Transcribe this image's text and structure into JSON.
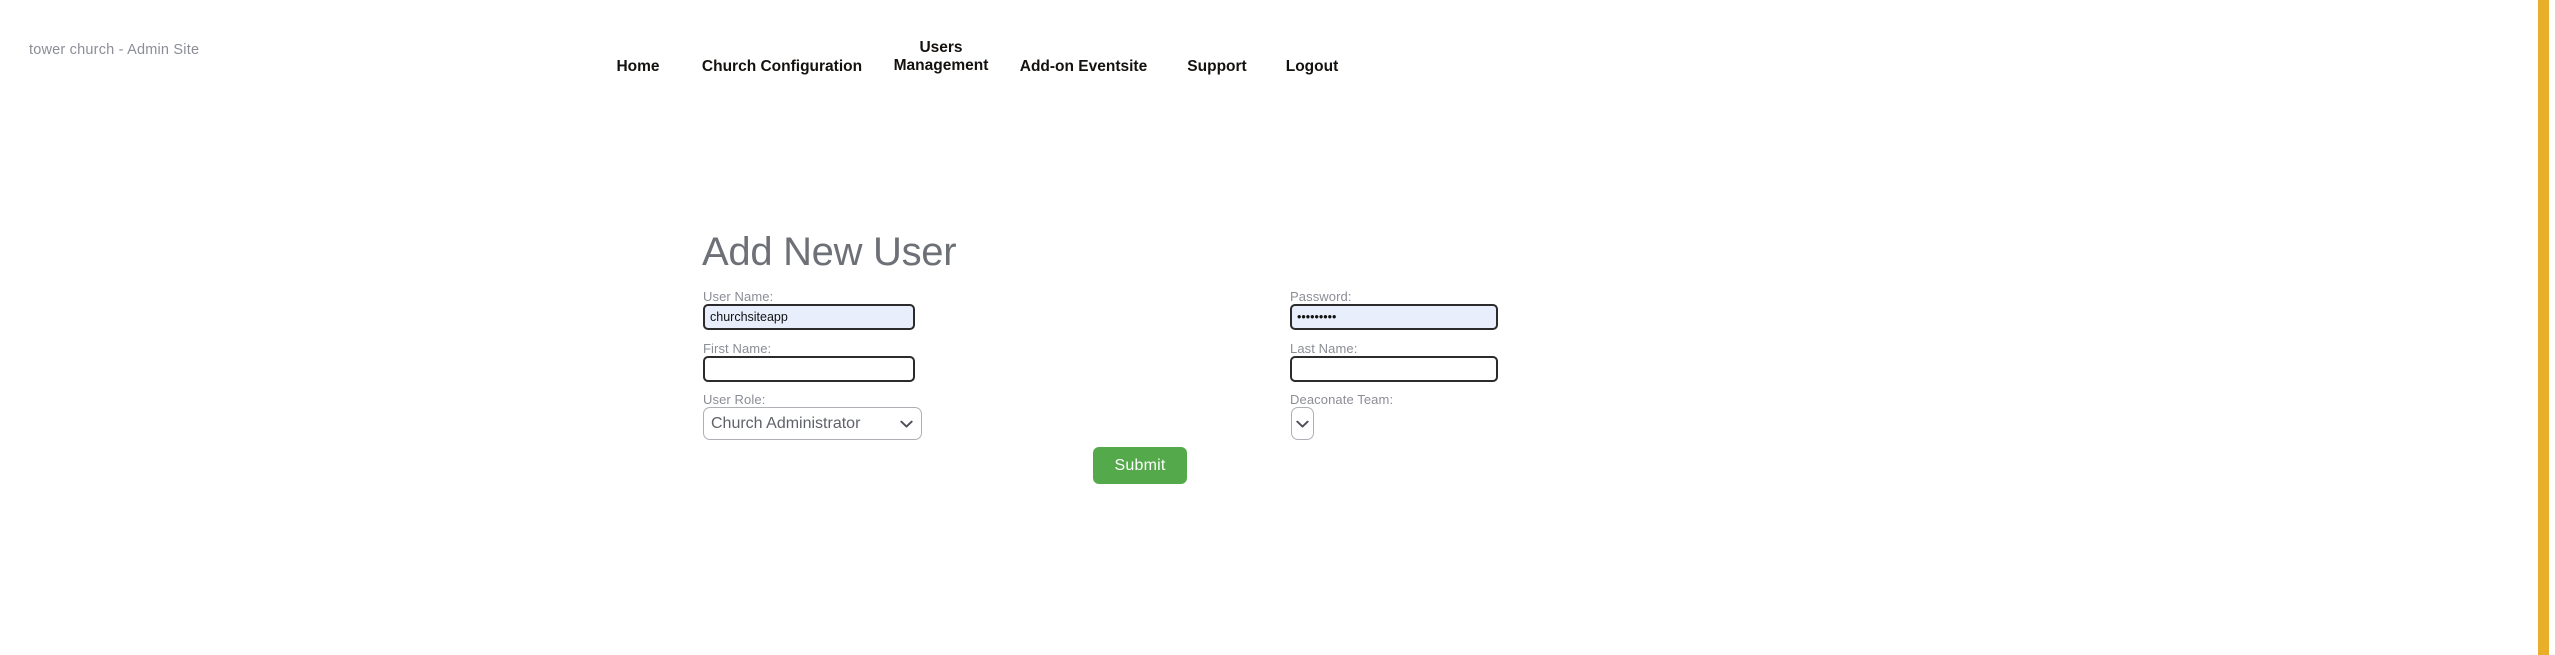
{
  "header": {
    "site_title": "tower church - Admin Site"
  },
  "nav": {
    "items": [
      {
        "label": "Home",
        "name": "nav-home"
      },
      {
        "label": "Church Configuration",
        "name": "nav-church-configuration"
      },
      {
        "label": "Users Management",
        "name": "nav-users-management"
      },
      {
        "label": "Add-on Eventsite",
        "name": "nav-addon-eventsite"
      },
      {
        "label": "Support",
        "name": "nav-support"
      },
      {
        "label": "Logout",
        "name": "nav-logout"
      }
    ]
  },
  "form": {
    "title": "Add New User",
    "fields": {
      "user_name": {
        "label": "User Name:",
        "value": "churchsiteapp",
        "placeholder": ""
      },
      "password": {
        "label": "Password:",
        "value": "•••••••••",
        "masked_length": 9,
        "placeholder": ""
      },
      "first_name": {
        "label": "First Name:",
        "value": "",
        "placeholder": ""
      },
      "last_name": {
        "label": "Last Name:",
        "value": "",
        "placeholder": ""
      },
      "user_role": {
        "label": "User Role:",
        "selected": "Church Administrator",
        "options": [
          "Church Administrator"
        ]
      },
      "deaconate_team": {
        "label": "Deaconate Team:",
        "selected": "",
        "options": [
          ""
        ]
      }
    },
    "submit_label": "Submit"
  },
  "icons": {
    "chevron_down": "⌄"
  },
  "colors": {
    "accent_green": "#54a94b",
    "scroll_stripe_gold": "#e9ae2a",
    "autofill_blue": "#e8eefc",
    "label_grey": "#8b8e95",
    "title_grey": "#6d7076"
  }
}
